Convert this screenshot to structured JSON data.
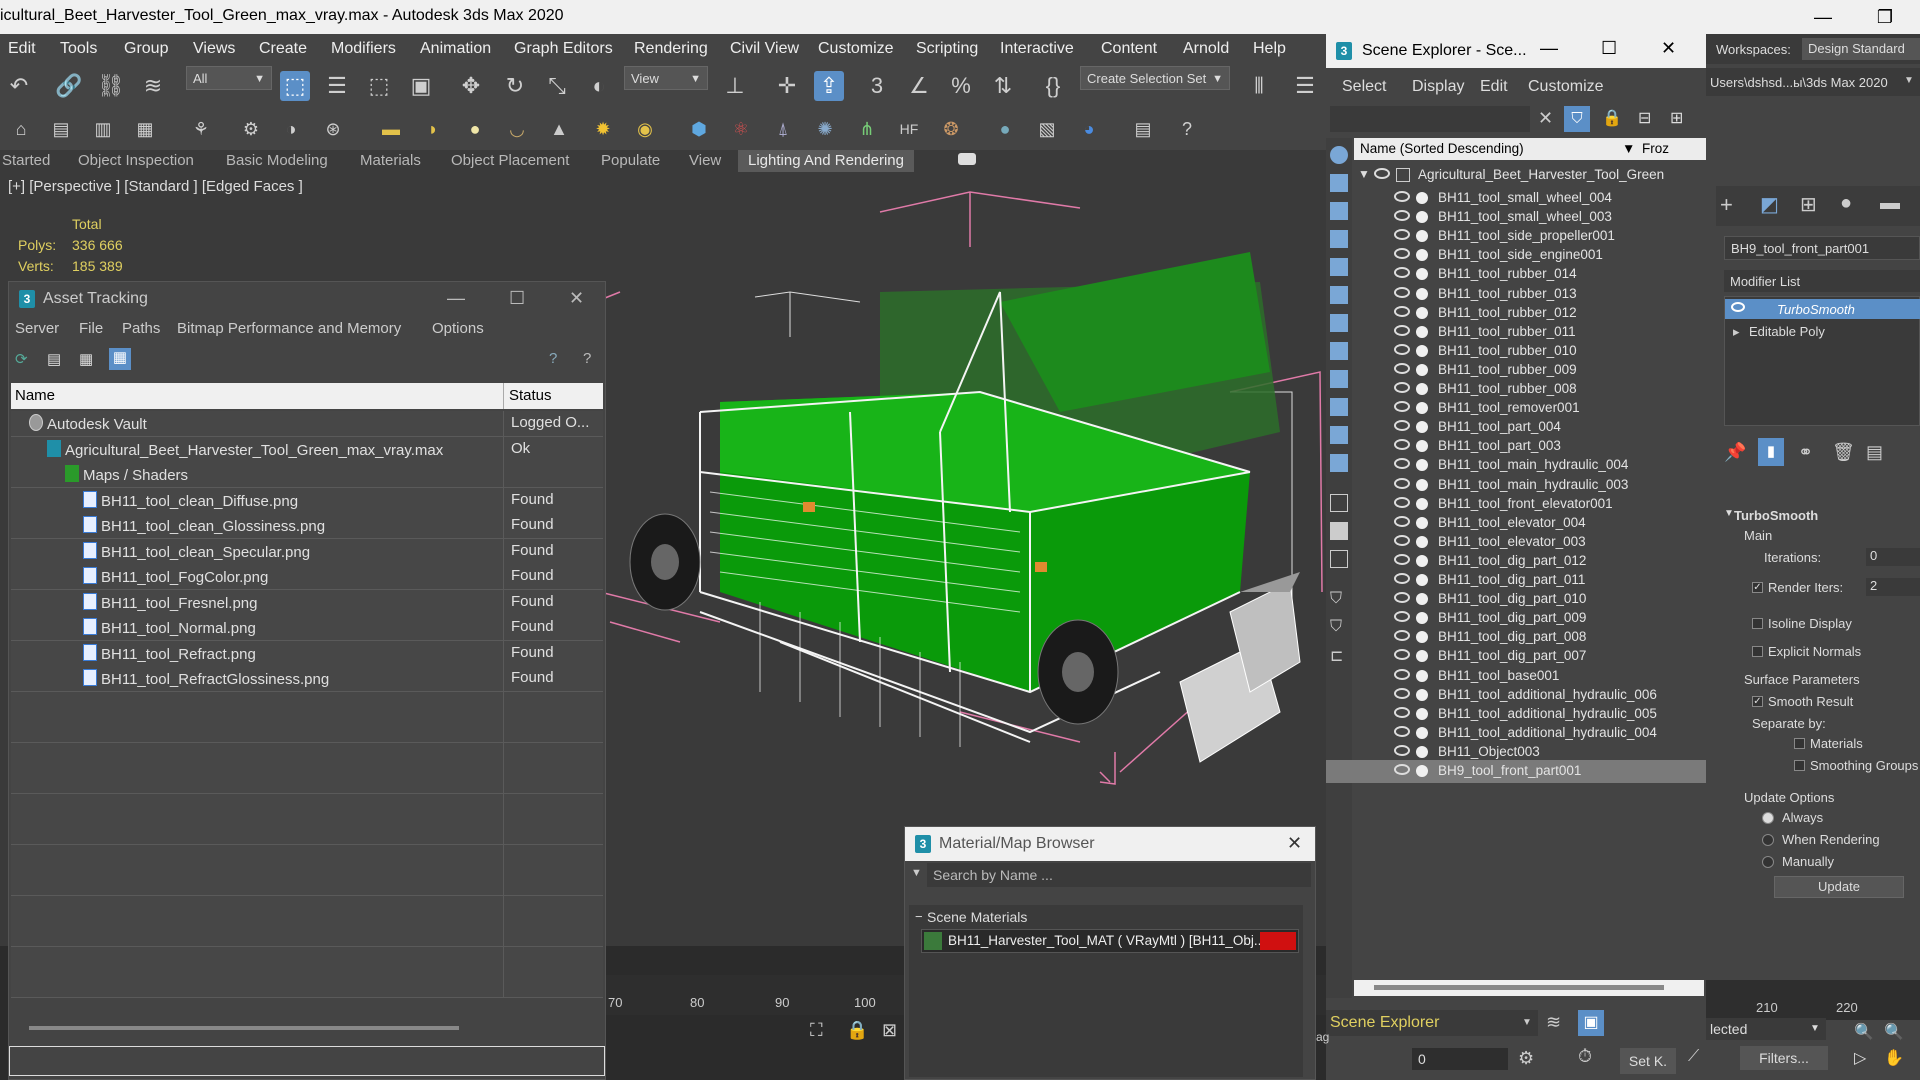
{
  "app": {
    "title": "icultural_Beet_Harvester_Tool_Green_max_vray.max - Autodesk 3ds Max 2020",
    "workspaces_label": "Workspaces:",
    "workspace_value": "Design Standard",
    "path_value": "Users\\dshsd...ы\\3ds Max 2020"
  },
  "menu": [
    "Edit",
    "Tools",
    "Group",
    "Views",
    "Create",
    "Modifiers",
    "Animation",
    "Graph Editors",
    "Rendering",
    "Civil View",
    "Customize",
    "Scripting",
    "Interactive",
    "Content",
    "Arnold",
    "Help"
  ],
  "toolbar": {
    "filter_value": "All",
    "view_value": "View",
    "selection_set_value": "Create Selection Set"
  },
  "ribbon_tabs": [
    "Started",
    "Object Inspection",
    "Basic Modeling",
    "Materials",
    "Object Placement",
    "Populate",
    "View",
    "Lighting And Rendering"
  ],
  "viewport": {
    "label": "[+] [Perspective ] [Standard ] [Edged Faces ]",
    "stats": {
      "total_label": "Total",
      "polys_label": "Polys:",
      "polys_value": "336 666",
      "verts_label": "Verts:",
      "verts_value": "185 389"
    }
  },
  "asset_tracking": {
    "title": "Asset Tracking",
    "menu": [
      "Server",
      "File",
      "Paths",
      "Bitmap Performance and Memory",
      "Options"
    ],
    "columns": {
      "name": "Name",
      "status": "Status"
    },
    "rows": [
      {
        "name": "Autodesk Vault",
        "status": "Logged O...",
        "indent": 0,
        "icon": "vault"
      },
      {
        "name": "Agricultural_Beet_Harvester_Tool_Green_max_vray.max",
        "status": "Ok",
        "indent": 1,
        "icon": "max"
      },
      {
        "name": "Maps / Shaders",
        "status": "",
        "indent": 2,
        "icon": "maps"
      },
      {
        "name": "BH11_tool_clean_Diffuse.png",
        "status": "Found",
        "indent": 3,
        "icon": "file"
      },
      {
        "name": "BH11_tool_clean_Glossiness.png",
        "status": "Found",
        "indent": 3,
        "icon": "file"
      },
      {
        "name": "BH11_tool_clean_Specular.png",
        "status": "Found",
        "indent": 3,
        "icon": "file"
      },
      {
        "name": "BH11_tool_FogColor.png",
        "status": "Found",
        "indent": 3,
        "icon": "file"
      },
      {
        "name": "BH11_tool_Fresnel.png",
        "status": "Found",
        "indent": 3,
        "icon": "file"
      },
      {
        "name": "BH11_tool_Normal.png",
        "status": "Found",
        "indent": 3,
        "icon": "file"
      },
      {
        "name": "BH11_tool_Refract.png",
        "status": "Found",
        "indent": 3,
        "icon": "file"
      },
      {
        "name": "BH11_tool_RefractGlossiness.png",
        "status": "Found",
        "indent": 3,
        "icon": "file"
      }
    ]
  },
  "scene_explorer": {
    "title": "Scene Explorer - Sce...",
    "menu": [
      "Select",
      "Display",
      "Edit",
      "Customize"
    ],
    "column_name": "Name (Sorted Descending)",
    "column_froz": "Froz",
    "root": "Agricultural_Beet_Harvester_Tool_Green",
    "items": [
      "BH11_tool_small_wheel_004",
      "BH11_tool_small_wheel_003",
      "BH11_tool_side_propeller001",
      "BH11_tool_side_engine001",
      "BH11_tool_rubber_014",
      "BH11_tool_rubber_013",
      "BH11_tool_rubber_012",
      "BH11_tool_rubber_011",
      "BH11_tool_rubber_010",
      "BH11_tool_rubber_009",
      "BH11_tool_rubber_008",
      "BH11_tool_remover001",
      "BH11_tool_part_004",
      "BH11_tool_part_003",
      "BH11_tool_main_hydraulic_004",
      "BH11_tool_main_hydraulic_003",
      "BH11_tool_front_elevator001",
      "BH11_tool_elevator_004",
      "BH11_tool_elevator_003",
      "BH11_tool_dig_part_012",
      "BH11_tool_dig_part_011",
      "BH11_tool_dig_part_010",
      "BH11_tool_dig_part_009",
      "BH11_tool_dig_part_008",
      "BH11_tool_dig_part_007",
      "BH11_tool_base001",
      "BH11_tool_additional_hydraulic_006",
      "BH11_tool_additional_hydraulic_005",
      "BH11_tool_additional_hydraulic_004",
      "BH11_Object003",
      "BH9_tool_front_part001"
    ],
    "footer_label": "Scene Explorer"
  },
  "command_panel": {
    "object_name": "BH9_tool_front_part001",
    "modifier_list": "Modifier List",
    "modifiers": [
      "TurboSmooth",
      "Editable Poly"
    ],
    "rollout_title": "TurboSmooth",
    "main_label": "Main",
    "iterations_label": "Iterations:",
    "iterations_value": "0",
    "render_iters_label": "Render Iters:",
    "render_iters_value": "2",
    "isoline_label": "Isoline Display",
    "explicit_label": "Explicit Normals",
    "surface_label": "Surface Parameters",
    "smooth_label": "Smooth Result",
    "separate_label": "Separate by:",
    "materials_label": "Materials",
    "smoothing_label": "Smoothing Groups",
    "update_options_label": "Update Options",
    "always_label": "Always",
    "when_rendering_label": "When Rendering",
    "manually_label": "Manually",
    "update_button": "Update"
  },
  "material_browser": {
    "title": "Material/Map Browser",
    "search_placeholder": "Search by Name ...",
    "section": "Scene Materials",
    "material": "BH11_Harvester_Tool_MAT  ( VRayMtl )  [BH11_Obj..."
  },
  "timeline": {
    "ticks": [
      "70",
      "80",
      "90",
      "100"
    ],
    "right_ticks": [
      "210",
      "220"
    ]
  },
  "status": {
    "selected_value": "lected",
    "spinner_value": "0",
    "setk_label": "Set K.",
    "filters_label": "Filters...",
    "ag_label": "ag"
  }
}
